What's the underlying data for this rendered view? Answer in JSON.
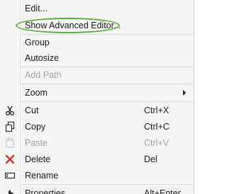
{
  "menu": {
    "items": [
      {
        "label": "Edit...",
        "disabled": false
      },
      {
        "label": "Show Advanced Editor...",
        "disabled": false
      },
      {
        "label": "Group",
        "disabled": false
      },
      {
        "label": "Autosize",
        "disabled": false
      },
      {
        "label": "Add Path",
        "disabled": true
      },
      {
        "label": "Zoom",
        "disabled": false,
        "submenu": true
      },
      {
        "label": "Cut",
        "shortcut": "Ctrl+X",
        "icon": "scissors-icon",
        "disabled": false
      },
      {
        "label": "Copy",
        "shortcut": "Ctrl+C",
        "icon": "copy-icon",
        "disabled": false
      },
      {
        "label": "Paste",
        "shortcut": "Ctrl+V",
        "icon": "paste-icon",
        "disabled": true
      },
      {
        "label": "Delete",
        "shortcut": "Del",
        "icon": "delete-icon",
        "disabled": false
      },
      {
        "label": "Rename",
        "icon": "rename-icon",
        "disabled": false
      },
      {
        "label": "Properties",
        "shortcut": "Alt+Enter",
        "icon": "wrench-icon",
        "disabled": false
      }
    ]
  },
  "colors": {
    "highlight_ellipse": "#5bab38",
    "delete_icon": "#d0312d",
    "disabled_text": "#a3a3a3",
    "menu_background": "#f5f5f5"
  }
}
